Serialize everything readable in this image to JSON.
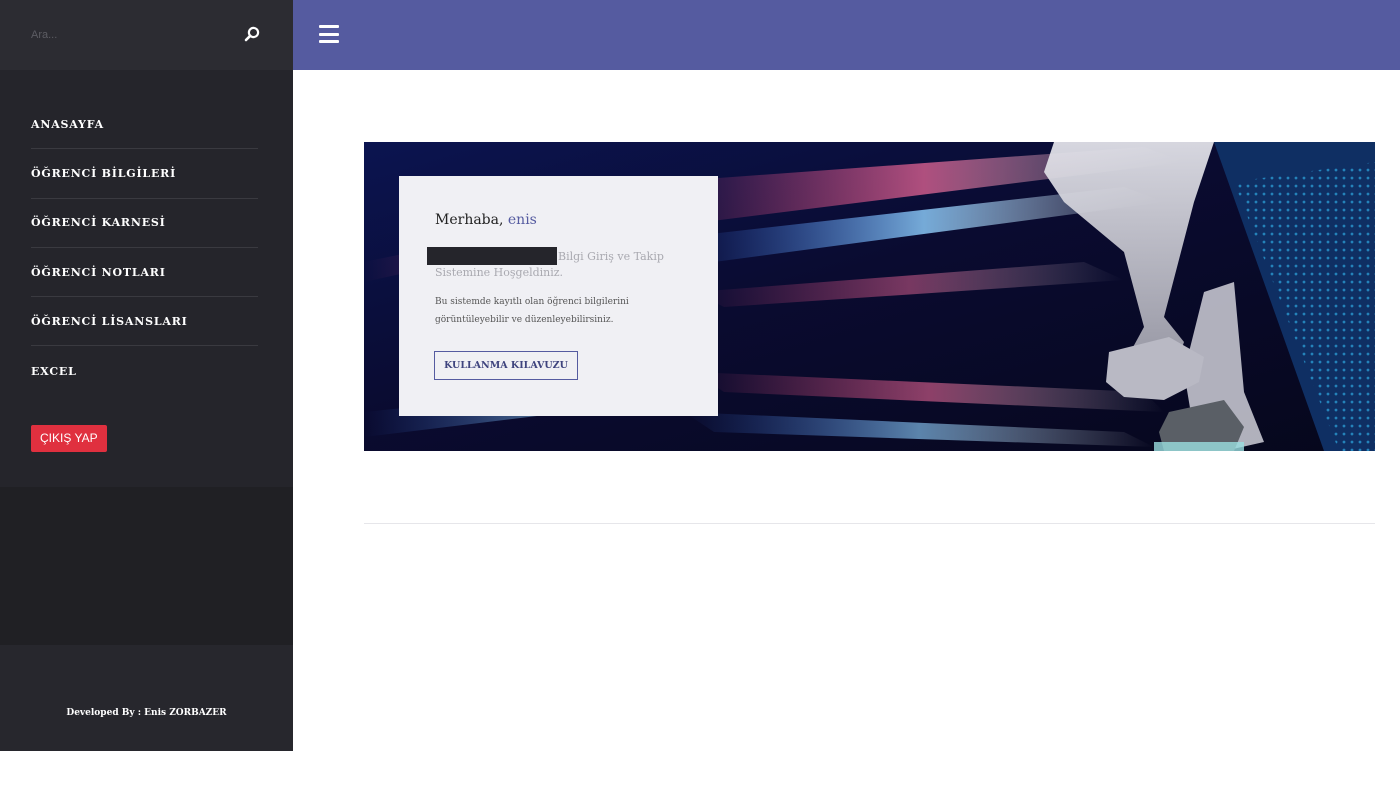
{
  "search": {
    "placeholder": "Ara..."
  },
  "sidebar": {
    "items": [
      {
        "label": "ANASAYFA"
      },
      {
        "label": "ÖĞRENCİ BİLGİLERİ"
      },
      {
        "label": "ÖĞRENCİ KARNESİ"
      },
      {
        "label": "ÖĞRENCİ NOTLARI"
      },
      {
        "label": "ÖĞRENCİ LİSANSLARI"
      },
      {
        "label": "EXCEL"
      }
    ],
    "logout_label": "ÇIKIŞ YAP",
    "credit": "Developed By : Enis ZORBAZER"
  },
  "welcome": {
    "greeting": "Merhaba,",
    "name": "enis",
    "line1": "Bilgi Giriş ve Takip",
    "line2": "Sistemine Hoşgeldiniz.",
    "desc_line1": "Bu sistemde kayıtlı olan öğrenci bilgilerini",
    "desc_line2": "görüntüleyebilir ve düzenleyebilirsiniz.",
    "guide_label": "KULLANMA KILAVUZU"
  },
  "icons": {
    "search": "search-icon",
    "menu": "hamburger-menu-icon"
  },
  "colors": {
    "sidebar": "#25252b",
    "topbar": "#555ba0",
    "accent": "#555ba0",
    "logout": "#e0303f"
  }
}
